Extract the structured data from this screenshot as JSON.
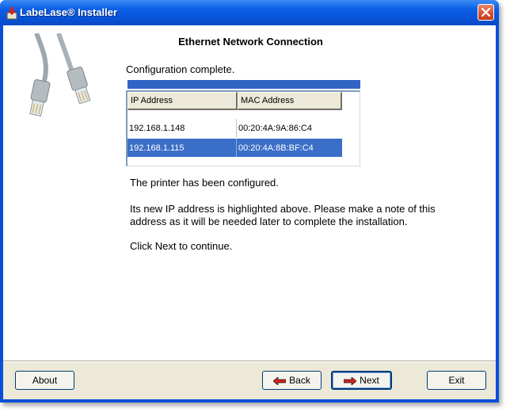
{
  "window": {
    "title": "LabeLase® Installer"
  },
  "page": {
    "heading": "Ethernet Network Connection",
    "status": "Configuration complete.",
    "progress": 1.0
  },
  "table": {
    "columns": [
      "IP Address",
      "MAC Address"
    ],
    "rows": [
      {
        "ip": "192.168.1.148",
        "mac": "00:20:4A:9A:86:C4",
        "selected": false
      },
      {
        "ip": "192.168.1.115",
        "mac": "00:20:4A:8B:BF:C4",
        "selected": true
      }
    ]
  },
  "messages": {
    "configured": "The printer has been configured.",
    "note": "Its new IP address is highlighted above.  Please make a note of this address as it will be needed later to complete the installation.",
    "next": "Click Next to continue."
  },
  "buttons": {
    "about": "About",
    "back": "Back",
    "next": "Next",
    "exit": "Exit"
  },
  "colors": {
    "titlebar": "#0653d9",
    "selection": "#3a6ec8",
    "progress": "#3163c5",
    "arrow": "#d4221c"
  }
}
